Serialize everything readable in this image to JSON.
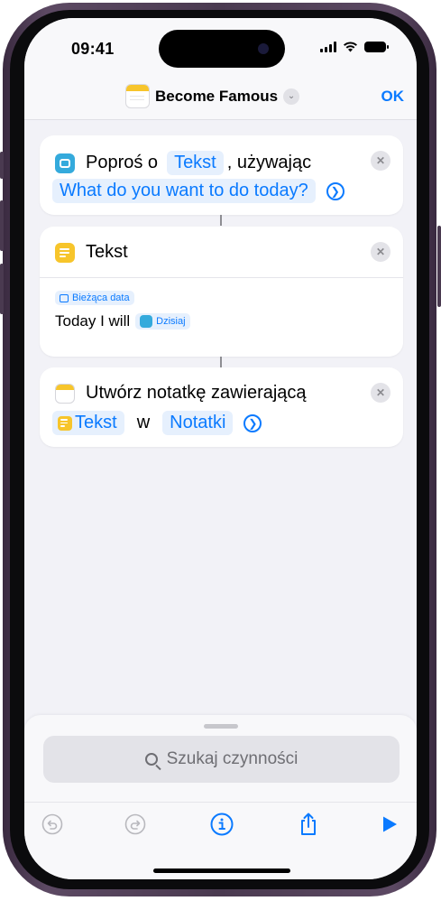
{
  "status_bar": {
    "time": "09:41"
  },
  "nav": {
    "title": "Become Famous",
    "ok_label": "OK"
  },
  "card_ask": {
    "prefix": "Poproś o",
    "type_chip": "Tekst",
    "suffix": ", używając",
    "prompt_chip": "What do you want to do today?"
  },
  "card_text": {
    "title": "Tekst",
    "current_date_chip": "Bieżąca data",
    "body_text": "Today I will",
    "variable_chip": "Dzisiaj"
  },
  "card_note": {
    "title": "Utwórz notatkę zawierającą",
    "text_chip": "Tekst",
    "in_label": "w",
    "app_chip": "Notatki"
  },
  "search": {
    "placeholder": "Szukaj czynności"
  },
  "colors": {
    "accent": "#0a7aff",
    "notes_yellow": "#f7c52b",
    "ask_blue": "#34aadc"
  },
  "icons": [
    "ask-for-input-icon",
    "text-icon",
    "notes-icon",
    "undo-icon",
    "redo-icon",
    "info-icon",
    "share-icon",
    "play-icon",
    "search-icon"
  ]
}
